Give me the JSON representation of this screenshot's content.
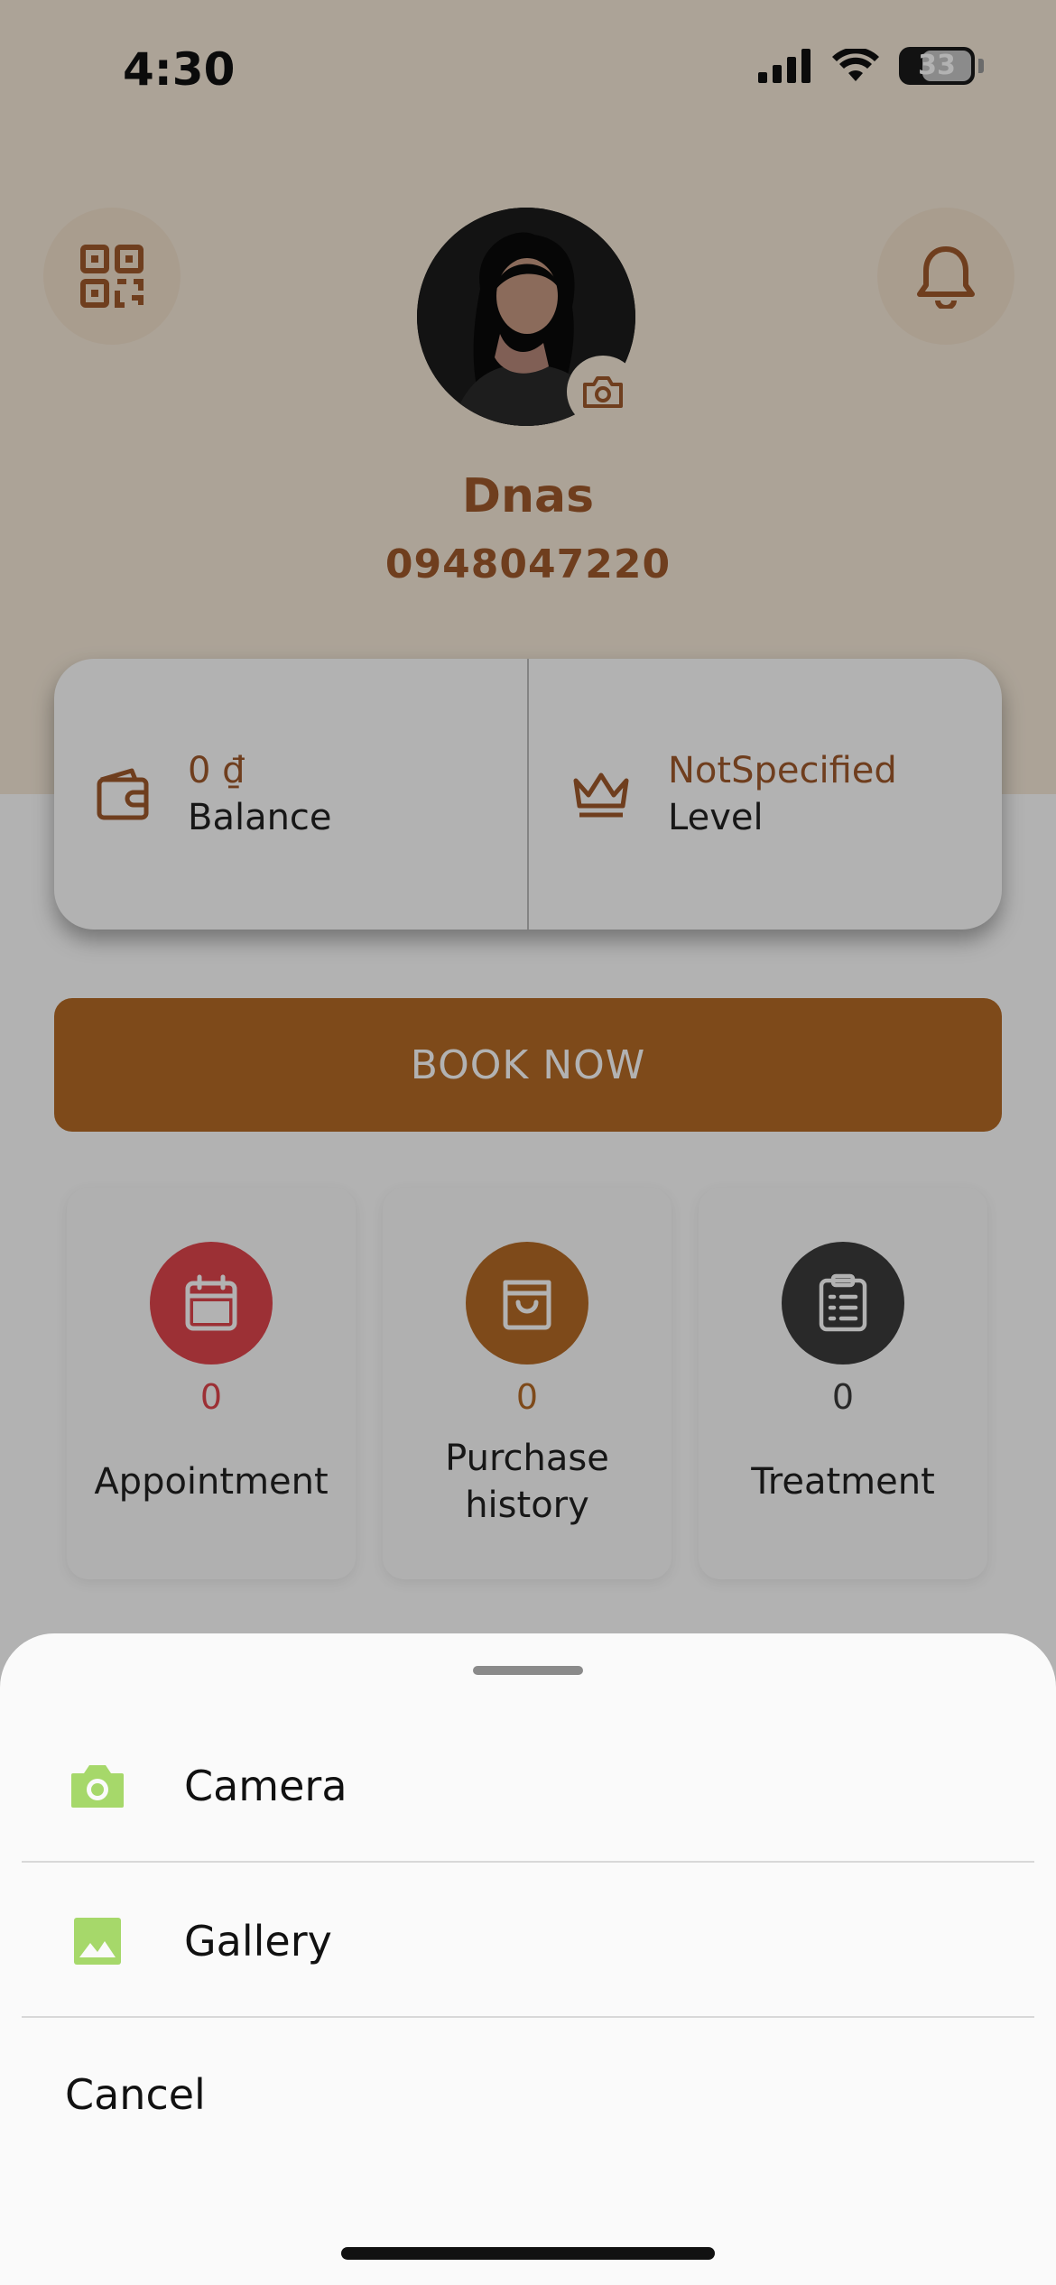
{
  "status_bar": {
    "time": "4:30",
    "battery": "33"
  },
  "profile": {
    "name": "Dnas",
    "phone": "0948047220"
  },
  "stats": {
    "balance": {
      "value": "0 ₫",
      "label": "Balance"
    },
    "level": {
      "value": "NotSpecified",
      "label": "Level"
    }
  },
  "book_button": {
    "label": "BOOK NOW"
  },
  "tiles": [
    {
      "count": "0",
      "label": "Appointment",
      "icon": "calendar-icon",
      "color": "#e0454c"
    },
    {
      "count": "0",
      "label_line1": "Purchase",
      "label_line2": "history",
      "icon": "shopping-bag-icon",
      "color": "#b56a26"
    },
    {
      "count": "0",
      "label": "Treatment",
      "icon": "clipboard-list-icon",
      "color": "#3b3b3b"
    }
  ],
  "sheet": {
    "options": [
      {
        "label": "Camera",
        "icon": "camera-icon"
      },
      {
        "label": "Gallery",
        "icon": "gallery-icon"
      }
    ],
    "cancel": "Cancel"
  },
  "colors": {
    "brand": "#b56a26",
    "accent_green": "#a6d86a",
    "header_bg": "#f6ead9"
  }
}
